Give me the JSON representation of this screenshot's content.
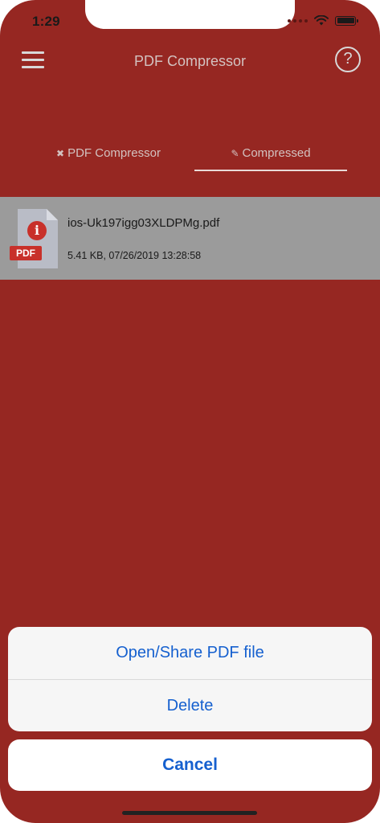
{
  "status_bar": {
    "time": "1:29"
  },
  "header": {
    "title": "PDF Compressor",
    "menu_icon": "hamburger-menu-icon",
    "help_icon": "question-circle-icon",
    "help_glyph": "?"
  },
  "tabs": [
    {
      "icon": "compress-arrows-icon",
      "glyph": "✖",
      "label": "PDF Compressor",
      "active": false
    },
    {
      "icon": "edit-square-icon",
      "glyph": "✎",
      "label": "Compressed",
      "active": true
    }
  ],
  "files": [
    {
      "name": "ios-Uk197igg03XLDPMg.pdf",
      "meta": "5.41 KB, 07/26/2019 13:28:58",
      "badge": "PDF",
      "info_glyph": "i"
    }
  ],
  "action_sheet": {
    "open_share_label": "Open/Share PDF file",
    "delete_label": "Delete",
    "cancel_label": "Cancel"
  },
  "colors": {
    "background": "#962722",
    "file_row": "#9b9b9b",
    "action_text": "#1560cf",
    "pdf_badge": "#c8302a"
  }
}
